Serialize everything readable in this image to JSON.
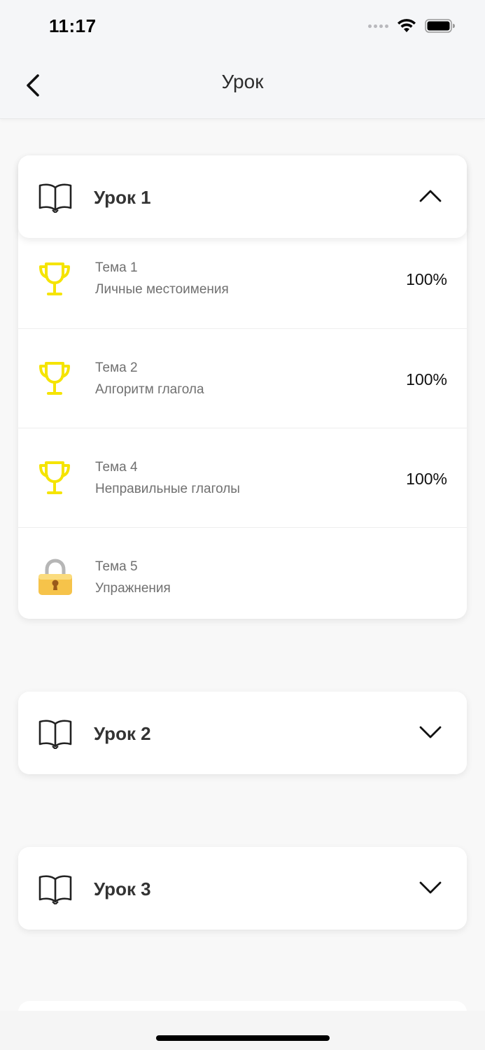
{
  "status_bar": {
    "time": "11:17",
    "icons": [
      "signal-icon",
      "wifi-icon",
      "battery-icon"
    ]
  },
  "nav": {
    "title": "Урок",
    "back_icon": "chevron-left-icon"
  },
  "colors": {
    "trophy": "#f5e400",
    "background": "#f8f8f8",
    "card": "#ffffff",
    "text_primary": "#333333",
    "text_secondary": "#707070"
  },
  "lessons": [
    {
      "title": "Урок 1",
      "icon": "book-icon",
      "expanded": true,
      "topics": [
        {
          "num": "Тема 1",
          "name": "Личные местоимения",
          "percent": "100%",
          "icon": "trophy-icon"
        },
        {
          "num": "Тема 2",
          "name": "Алгоритм глагола",
          "percent": "100%",
          "icon": "trophy-icon"
        },
        {
          "num": "Тема 4",
          "name": "Неправильные глаголы",
          "percent": "100%",
          "icon": "trophy-icon"
        },
        {
          "num": "Тема 5",
          "name": "Упражнения",
          "percent": "",
          "icon": "lock-icon"
        }
      ]
    },
    {
      "title": "Урок 2",
      "icon": "book-icon",
      "expanded": false
    },
    {
      "title": "Урок 3",
      "icon": "book-icon",
      "expanded": false
    }
  ]
}
